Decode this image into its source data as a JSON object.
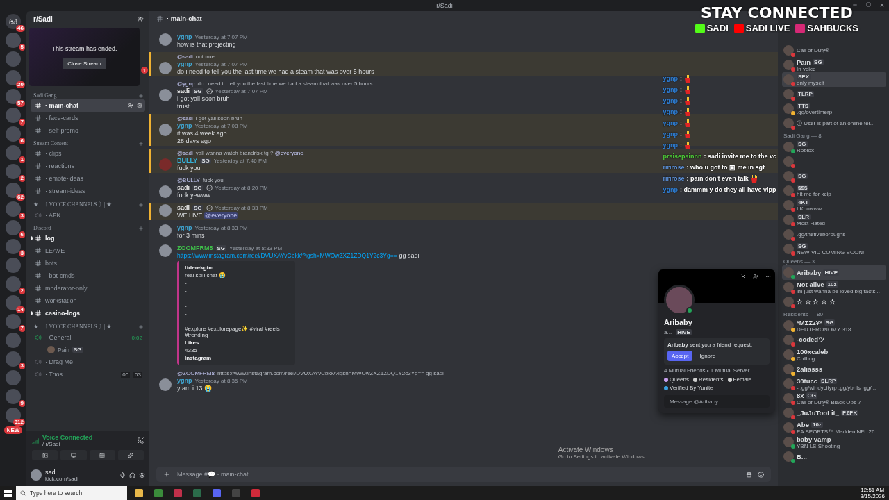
{
  "title_bar": {
    "title": "r/Sadi"
  },
  "stream_overlay": {
    "heading": "STAY CONNECTED",
    "links": [
      {
        "kind": "kick",
        "label": "SADI"
      },
      {
        "kind": "youtube",
        "label": "SADI LIVE"
      },
      {
        "kind": "instagram",
        "label": "SAHBUCKS"
      }
    ]
  },
  "servers": [
    {
      "badge": "46",
      "kind": "home"
    },
    {
      "badge": "5",
      "kind": "server"
    },
    {
      "kind": "server"
    },
    {
      "badge": "20",
      "kind": "server"
    },
    {
      "badge": "57",
      "kind": "server"
    },
    {
      "badge": "7",
      "kind": "server"
    },
    {
      "badge": "6",
      "kind": "server"
    },
    {
      "badge": "1",
      "kind": "server"
    },
    {
      "badge": "2",
      "kind": "server"
    },
    {
      "badge": "62",
      "kind": "server"
    },
    {
      "badge": "3",
      "kind": "server"
    },
    {
      "badge": "6",
      "kind": "server"
    },
    {
      "badge": "3",
      "kind": "server"
    },
    {
      "kind": "server"
    },
    {
      "badge": "2",
      "kind": "server"
    },
    {
      "badge": "14",
      "kind": "server"
    },
    {
      "badge": "7",
      "kind": "server"
    },
    {
      "kind": "server"
    },
    {
      "badge": "3",
      "kind": "server"
    },
    {
      "kind": "server"
    },
    {
      "badge": "9",
      "kind": "server"
    },
    {
      "badge": "312",
      "kind": "server"
    }
  ],
  "new_pill": "NEW",
  "server_header": {
    "name": "r/Sadi"
  },
  "stream_panel": {
    "message": "This stream has ended.",
    "button": "Close Stream",
    "badge": "1"
  },
  "channels": [
    {
      "kind": "category",
      "name": "Sadi Gang"
    },
    {
      "kind": "text",
      "name": "· main-chat",
      "selected": true,
      "unread": false
    },
    {
      "kind": "text",
      "name": "· face-cards",
      "selected": false,
      "unread": false
    },
    {
      "kind": "text",
      "name": "· self-promo",
      "selected": false,
      "unread": false
    },
    {
      "kind": "category",
      "name": "Stream Content"
    },
    {
      "kind": "text",
      "name": "· clips",
      "selected": false,
      "unread": false
    },
    {
      "kind": "text",
      "name": "· reactions",
      "selected": false,
      "unread": false
    },
    {
      "kind": "text",
      "name": "· emote-ideas",
      "selected": false,
      "unread": false
    },
    {
      "kind": "text",
      "name": "· stream-ideas",
      "selected": false,
      "unread": false
    },
    {
      "kind": "category",
      "name": "★ | 〔 VOICE CHANNELS 〕| ★"
    },
    {
      "kind": "voice",
      "name": "· AFK",
      "active": false
    },
    {
      "kind": "category",
      "name": "Discord"
    },
    {
      "kind": "text",
      "name": "log",
      "selected": false,
      "unread": true
    },
    {
      "kind": "text",
      "name": "LEAVE",
      "selected": false,
      "unread": false
    },
    {
      "kind": "text",
      "name": "bots",
      "selected": false,
      "unread": false
    },
    {
      "kind": "text",
      "name": "· bot-cmds",
      "selected": false,
      "unread": false
    },
    {
      "kind": "text",
      "name": "moderator-only",
      "selected": false,
      "unread": false
    },
    {
      "kind": "text",
      "name": "workstation",
      "selected": false,
      "unread": false
    },
    {
      "kind": "text",
      "name": "casino-logs",
      "selected": false,
      "unread": true
    },
    {
      "kind": "category",
      "name": "★ | 〔 VOICE CHANNELS 〕| ★"
    },
    {
      "kind": "voice",
      "name": "· General",
      "active": true,
      "timer": "0:02"
    },
    {
      "kind": "member",
      "name": "Pain",
      "tag": "SG"
    },
    {
      "kind": "voice",
      "name": "· Drag Me",
      "active": false
    },
    {
      "kind": "voice",
      "name": "· Trios",
      "active": false,
      "counts": [
        "00",
        "03"
      ]
    }
  ],
  "voice_panel": {
    "status": "Voice Connected",
    "location": "/ r/Sadi"
  },
  "user_panel": {
    "name": "sadi",
    "status": "kick.com/sadi"
  },
  "chat": {
    "channel": "· main-chat",
    "input_placeholder": "Message #💬 · main-chat",
    "messages": [
      {
        "author": "ygnp",
        "color": "#3fa9d6",
        "time": "Yesterday at 7:07 PM",
        "lines": [
          "how is that projecting"
        ],
        "mentioned": false
      },
      {
        "reply": {
          "to": "@sadi",
          "text": "not true"
        },
        "author": "ygnp",
        "color": "#3fa9d6",
        "time": "Yesterday at 7:07 PM",
        "lines": [
          "do i need to tell you the last time we had a steam that was over 5 hours"
        ],
        "mentioned": true
      },
      {
        "reply": {
          "to": "@ygnp",
          "text": "do i need to tell you the last time we had a steam that was over 5 hours"
        },
        "author": "sadi",
        "color": "#e6e6e6",
        "tag": "SG",
        "verified": true,
        "time": "Yesterday at 7:07 PM",
        "lines": [
          "i got yall soon bruh",
          "trust"
        ],
        "mentioned": false
      },
      {
        "reply": {
          "to": "@sadi",
          "text": "i got yall soon bruh"
        },
        "author": "ygnp",
        "color": "#3fa9d6",
        "time": "Yesterday at 7:08 PM",
        "lines": [
          "it was 4 week ago",
          "28 days ago"
        ],
        "mentioned": true
      },
      {
        "reply": {
          "to": "@sadi",
          "text": "yall wanna watch brandrisk tg ? **@everyone**"
        },
        "author": "BULLY",
        "color": "#36b3d9",
        "tag": "SG",
        "time": "Yesterday at 7:46 PM",
        "lines": [
          "fuck you"
        ],
        "mentioned": true
      },
      {
        "reply": {
          "to": "@BULLY",
          "text": "fuck you"
        },
        "author": "sadi",
        "color": "#e6e6e6",
        "tag": "SG",
        "verified": true,
        "time": "Yesterday at 8:20 PM",
        "lines": [
          "fuck yewww"
        ],
        "mentioned": false
      },
      {
        "author": "sadi",
        "color": "#e6e6e6",
        "tag": "SG",
        "verified": true,
        "time": "Yesterday at 8:33 PM",
        "lines": [
          "WE LIVE **@everyone**"
        ],
        "mentioned": true
      },
      {
        "author": "ygnp",
        "color": "#3fa9d6",
        "time": "Yesterday at 8:33 PM",
        "lines": [
          "for 3 mins"
        ],
        "mentioned": false
      },
      {
        "author": "ZOOMFRM8",
        "color": "#3fbf4a",
        "tag": "SG",
        "time": "Yesterday at 8:33 PM",
        "link": "https://www.instagram.com/reel/DVUXAYvCbkk/?igsh=MWOwZXZ1ZDQ1Y2c3Yg==",
        "link_suffix": "gg sadi",
        "mentioned": false,
        "embed": {
          "author": "ttderekgtm",
          "lines": [
            "real spill chat 😭",
            "-",
            "-",
            "-",
            "-",
            "-",
            "-",
            "#explore #explorepage✨ #viral #reels #trending"
          ],
          "field_name": "Likes",
          "field_value": "4335",
          "footer": "Instagram"
        }
      },
      {
        "reply": {
          "to": "@ZOOMFRM8",
          "text": "https://www.instagram.com/reel/DVUXAYvCbkk/?igsh=MWOwZXZ1ZDQ1Y2c3Yg== gg sadi"
        },
        "author": "ygnp",
        "color": "#3fa9d6",
        "time": "Yesterday at 8:35 PM",
        "lines": [
          "y am i 13 😭"
        ],
        "mentioned": false
      }
    ]
  },
  "stream_chat": [
    {
      "user": "ygnp",
      "color": "#2f7fd6",
      "text": ":",
      "emote": true
    },
    {
      "user": "ygnp",
      "color": "#2f7fd6",
      "text": ":",
      "emote": true
    },
    {
      "user": "ygnp",
      "color": "#2f7fd6",
      "text": ":",
      "emote": true
    },
    {
      "user": "ygnp",
      "color": "#2f7fd6",
      "text": ":",
      "emote": true
    },
    {
      "user": "ygnp",
      "color": "#2f7fd6",
      "text": ":",
      "emote": true
    },
    {
      "user": "ygnp",
      "color": "#2f7fd6",
      "text": ":",
      "emote": true
    },
    {
      "user": "ygnp",
      "color": "#2f7fd6",
      "text": ":",
      "emote": true
    },
    {
      "user": "praisepainnn",
      "color": "#4fd13a",
      "text": ": sadi invite me to the vc",
      "emote": false
    },
    {
      "user": "ririrose",
      "color": "#5b8fd6",
      "text": ": who u got to ▣ me in sgf",
      "emote": false
    },
    {
      "user": "ririrose",
      "color": "#5b8fd6",
      "text": ": pain don't even talk",
      "emote": true
    },
    {
      "user": "ygnp",
      "color": "#2f7fd6",
      "text": ": dammm y do they all have vipp",
      "emote": false
    }
  ],
  "profile": {
    "name": "Aribaby",
    "handle": "a...",
    "tag": "HIVE",
    "request_text": "**Aribaby** sent you a friend request.",
    "accept": "Accept",
    "ignore": "Ignore",
    "mutuals": "4 Mutual Friends • 1 Mutual Server",
    "roles": [
      {
        "name": "Queens",
        "color": "#c9a0f0"
      },
      {
        "name": "Residents",
        "color": "#cfcfcf"
      },
      {
        "name": "Female",
        "color": "#cfcfcf"
      },
      {
        "name": "Verified By Yunite",
        "color": "#3aa0e0"
      }
    ],
    "message_placeholder": "Message @Aribaby"
  },
  "member_groups": [
    {
      "members": [
        {
          "activity": "Call of Duty®",
          "color": "#da373c"
        },
        {
          "name": "Pain",
          "tag": "SG",
          "activity": "In voice",
          "color": "#da373c"
        },
        {
          "tag": "SEX",
          "activity": "only myself",
          "color": "#da373c",
          "highlight": true
        },
        {
          "tag": "TLRP",
          "color": "#da373c"
        },
        {
          "tag": "TTS",
          "activity": ".gg/overtimerp",
          "color": "#f0b232"
        },
        {
          "activity": "ⓘ User is part of an online ter...",
          "color": "#da373c"
        }
      ]
    },
    {
      "header": "Sadi Gang — 8",
      "members": [
        {
          "tag": "SG",
          "activity": "Roblox",
          "color": "#23a559"
        },
        {
          "color": "#da373c"
        },
        {
          "tag": "SG",
          "color": "#da373c"
        },
        {
          "tag": "$$$",
          "activity": "hit me for kcip",
          "color": "#da373c"
        },
        {
          "tag": "4KT",
          "activity": "I Knowww",
          "color": "#da373c"
        },
        {
          "tag": "SLR",
          "activity": "Most Hated",
          "color": "#da373c"
        },
        {
          "activity": ".gg/thefiveboroughs",
          "color": "#da373c"
        },
        {
          "tag": "SG",
          "activity": "NEW VID COMING SOON!",
          "color": "#da373c"
        }
      ]
    },
    {
      "header": "Queens — 3",
      "members": [
        {
          "name": "Aribaby",
          "tag": "HIVE",
          "color": "#23a559",
          "highlight": true
        },
        {
          "name": "Not alive",
          "tag": "10z",
          "activity": "im just wanna be loved big facts...",
          "color": "#da373c"
        },
        {
          "name": "☆ ☆ ☆ ☆ ☆",
          "color": "#da373c"
        }
      ]
    },
    {
      "header": "Residents — 80",
      "members": [
        {
          "name": "*MΣZz¥*",
          "tag": "SG",
          "activity": "DEUTERONOMY 318",
          "color": "#f0b232"
        },
        {
          "name": "-codedツ",
          "color": "#da373c"
        },
        {
          "name": "100xcaleb",
          "activity": "Chilling",
          "color": "#f0b232"
        },
        {
          "name": "2aliasss",
          "color": "#f0b232"
        },
        {
          "name": "30tucc",
          "tag": "SLRP",
          "activity": "- .gg/windycityrp .gg/ybnls .gg/...",
          "color": "#da373c"
        },
        {
          "name": "8x",
          "tag": "OG",
          "activity": "Call of Duty® Black Ops 7",
          "color": "#da373c"
        },
        {
          "name": "_JuJuTooLit_",
          "tag": "PZPK",
          "color": "#da373c"
        },
        {
          "name": "Abe",
          "tag": "10z",
          "activity": "EA SPORTS™ Madden NFL 26",
          "color": "#da373c"
        },
        {
          "name": "baby vamp",
          "activity": "YBN LS Shooting",
          "color": "#23a559"
        },
        {
          "name": "B...",
          "color": "#23a559"
        }
      ]
    }
  ],
  "watermark": {
    "title": "Activate Windows",
    "subtitle": "Go to Settings to activate Windows."
  },
  "taskbar": {
    "search_placeholder": "Type here to search",
    "time": "12:51 AM",
    "date": "3/15/2026"
  }
}
